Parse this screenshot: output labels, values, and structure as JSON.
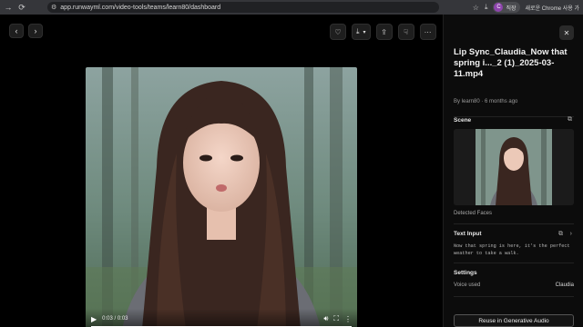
{
  "browser": {
    "url": "app.runwayml.com/video-tools/teams/learn80/dashboard",
    "profile_initial": "C",
    "profile_name": "직장",
    "update_text": "새로운 Chrome 사용 가"
  },
  "icons": {
    "back": "chevron-left-icon",
    "forward": "chevron-right-icon",
    "favorite": "heart-icon",
    "download": "download-icon",
    "share": "share-icon",
    "dislike": "thumbs-down-icon",
    "more": "more-icon",
    "close": "close-icon",
    "copy": "copy-icon"
  },
  "player": {
    "time": "0:03 / 0:03",
    "progress": 1.0
  },
  "panel": {
    "title": "Lip Sync_Claudia_Now that spring i..._2 (1)_2025-03-11.mp4",
    "meta": "By learn80 · 6 months ago",
    "scene_label": "Scene",
    "detected_faces": "Detected Faces",
    "text_input_label": "Text Input",
    "text_input_value": "Now that spring is here, it's the perfect weather to take a walk.",
    "settings_label": "Settings",
    "voice_used_label": "Voice used",
    "voice_used_value": "Claudia",
    "reuse_button": "Reuse in Generative Audio"
  },
  "colors": {
    "background": "#000000",
    "panel": "#0c0c0c",
    "chrome": "#35363a",
    "profile_avatar": "#8e44ad"
  }
}
